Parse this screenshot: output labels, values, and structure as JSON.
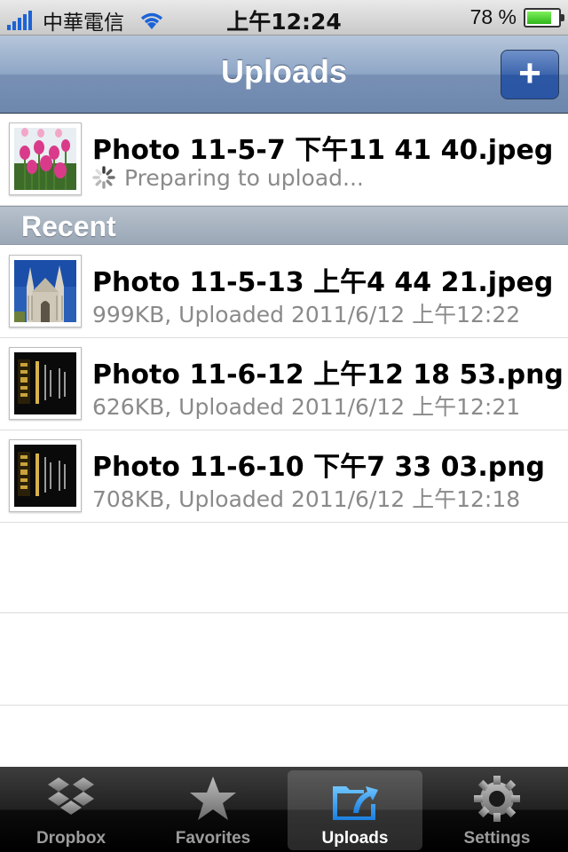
{
  "status_bar": {
    "carrier": "中華電信",
    "time": "上午12:24",
    "battery_text": "78 %",
    "battery_level": 0.78
  },
  "nav": {
    "title": "Uploads",
    "add_label": "+"
  },
  "pending": {
    "title": "Photo 11-5-7 下午11 41 40.jpeg",
    "status": "Preparing to upload..."
  },
  "recent": {
    "header": "Recent",
    "items": [
      {
        "title": "Photo 11-5-13 上午4 44 21.jpeg",
        "subtitle": "999KB, Uploaded 2011/6/12 上午12:22",
        "thumb": "cathedral"
      },
      {
        "title": "Photo 11-6-12 上午12 18 53.png",
        "subtitle": "626KB, Uploaded 2011/6/12 上午12:21",
        "thumb": "card"
      },
      {
        "title": "Photo 11-6-10 下午7 33 03.png",
        "subtitle": "708KB, Uploaded 2011/6/12 上午12:18",
        "thumb": "card"
      }
    ]
  },
  "tabs": [
    {
      "label": "Dropbox",
      "icon": "dropbox-icon",
      "selected": false
    },
    {
      "label": "Favorites",
      "icon": "star-icon",
      "selected": false
    },
    {
      "label": "Uploads",
      "icon": "upload-folder-icon",
      "selected": true
    },
    {
      "label": "Settings",
      "icon": "gear-icon",
      "selected": false
    }
  ],
  "colors": {
    "nav_blue": "#7890b4",
    "selected_tab_text": "#ffffff",
    "subtitle_gray": "#8a8a8a"
  }
}
